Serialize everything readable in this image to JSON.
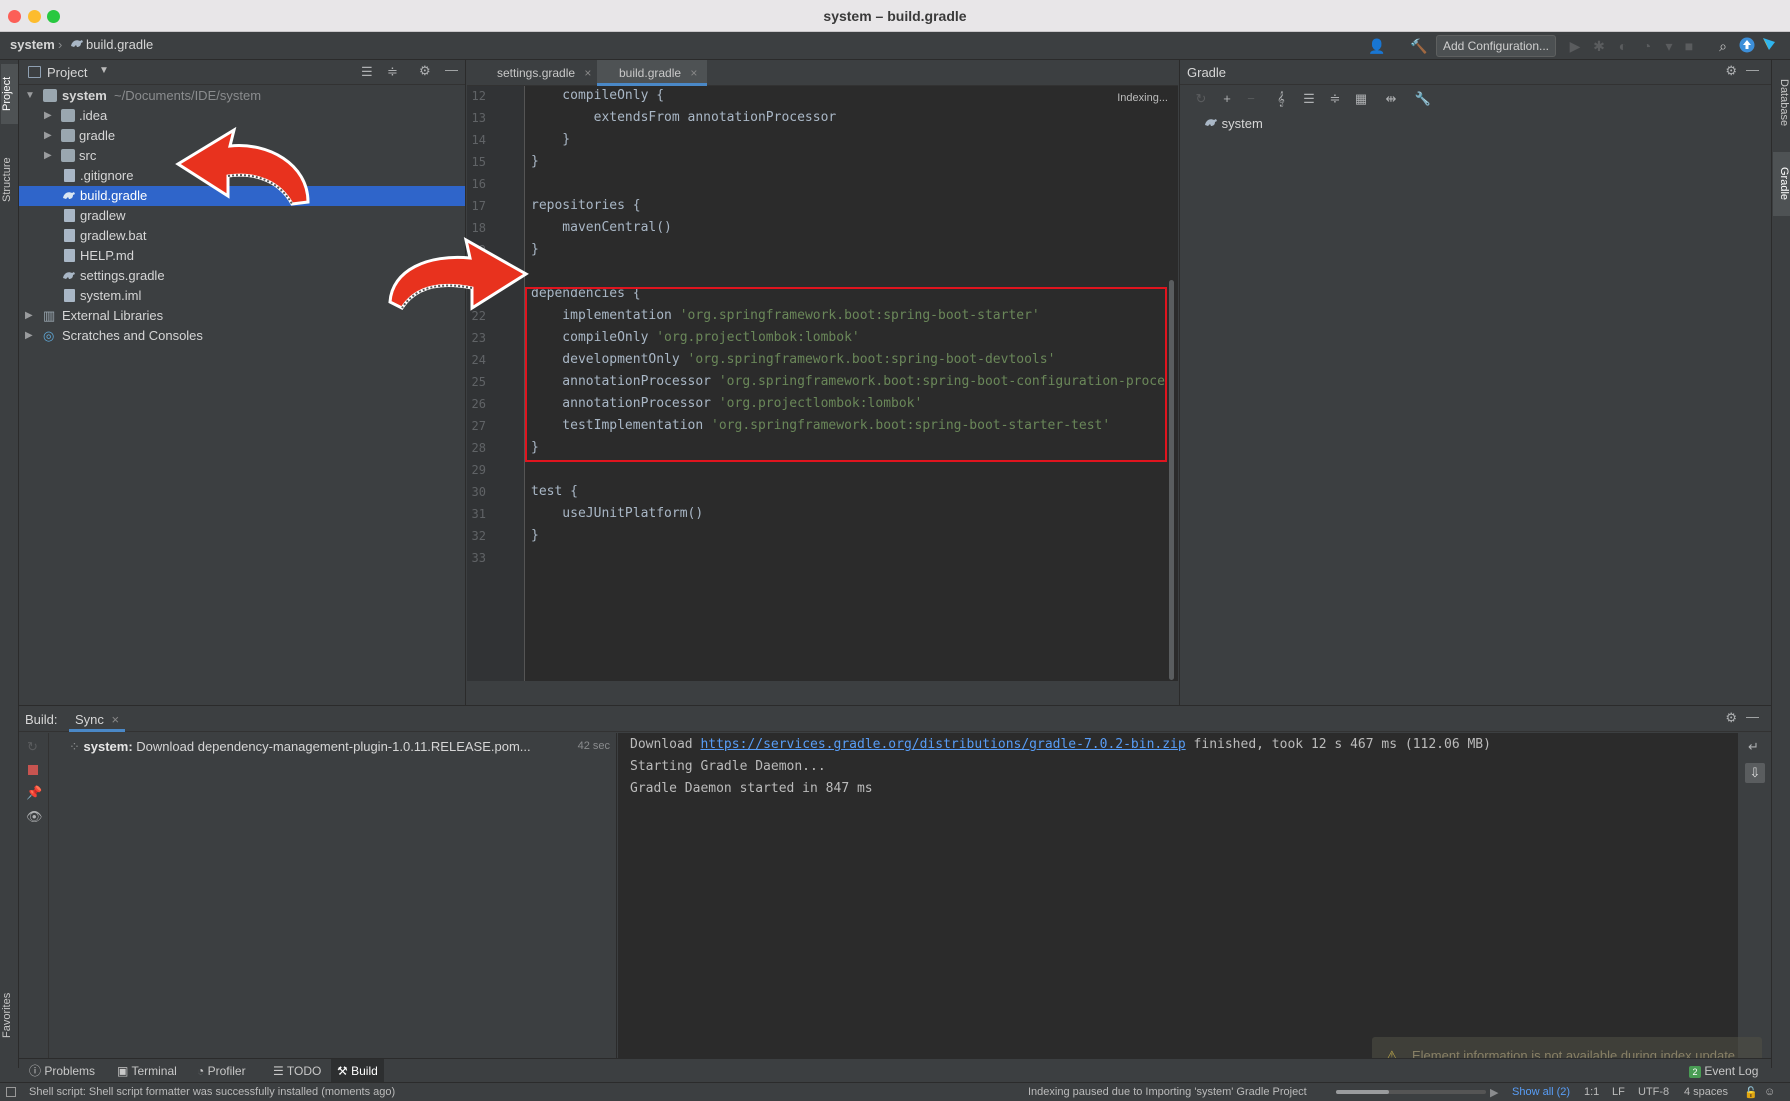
{
  "window": {
    "title": "system – build.gradle"
  },
  "navbar": {
    "crumb_project": "system",
    "crumb_file": "build.gradle",
    "add_configuration": "Add Configuration..."
  },
  "left_stripe": {
    "project": "Project",
    "structure": "Structure",
    "favorites": "Favorites"
  },
  "right_stripe": {
    "database": "Database",
    "gradle": "Gradle"
  },
  "project_panel": {
    "title": "Project",
    "root_name": "system",
    "root_path": "~/Documents/IDE/system",
    "items": [
      {
        "label": ".idea",
        "kind": "folder"
      },
      {
        "label": "gradle",
        "kind": "folder"
      },
      {
        "label": "src",
        "kind": "folder"
      },
      {
        "label": ".gitignore",
        "kind": "file"
      },
      {
        "label": "build.gradle",
        "kind": "gradle"
      },
      {
        "label": "gradlew",
        "kind": "file"
      },
      {
        "label": "gradlew.bat",
        "kind": "file"
      },
      {
        "label": "HELP.md",
        "kind": "file"
      },
      {
        "label": "settings.gradle",
        "kind": "gradle"
      },
      {
        "label": "system.iml",
        "kind": "file"
      }
    ],
    "external_libraries": "External Libraries",
    "scratches": "Scratches and Consoles"
  },
  "editor": {
    "tabs": [
      {
        "label": "settings.gradle"
      },
      {
        "label": "build.gradle"
      }
    ],
    "indexing_status": "Indexing...",
    "lines": [
      {
        "n": "12",
        "code": "    compileOnly {",
        "str": ""
      },
      {
        "n": "13",
        "code": "        extendsFrom annotationProcessor",
        "str": ""
      },
      {
        "n": "14",
        "code": "    }",
        "str": ""
      },
      {
        "n": "15",
        "code": "}",
        "str": ""
      },
      {
        "n": "16",
        "code": "",
        "str": ""
      },
      {
        "n": "17",
        "code": "repositories {",
        "str": ""
      },
      {
        "n": "18",
        "code": "    mavenCentral()",
        "str": ""
      },
      {
        "n": "19",
        "code": "}",
        "str": ""
      },
      {
        "n": "20",
        "code": "",
        "str": ""
      },
      {
        "n": "21",
        "code": "dependencies {",
        "str": ""
      },
      {
        "n": "22",
        "code": "    implementation ",
        "str": "'org.springframework.boot:spring-boot-starter'"
      },
      {
        "n": "23",
        "code": "    compileOnly ",
        "str": "'org.projectlombok:lombok'"
      },
      {
        "n": "24",
        "code": "    developmentOnly ",
        "str": "'org.springframework.boot:spring-boot-devtools'"
      },
      {
        "n": "25",
        "code": "    annotationProcessor ",
        "str": "'org.springframework.boot:spring-boot-configuration-proce"
      },
      {
        "n": "26",
        "code": "    annotationProcessor ",
        "str": "'org.projectlombok:lombok'"
      },
      {
        "n": "27",
        "code": "    testImplementation ",
        "str": "'org.springframework.boot:spring-boot-starter-test'"
      },
      {
        "n": "28",
        "code": "}",
        "str": ""
      },
      {
        "n": "29",
        "code": "",
        "str": ""
      },
      {
        "n": "30",
        "code": "test {",
        "str": ""
      },
      {
        "n": "31",
        "code": "    useJUnitPlatform()",
        "str": ""
      },
      {
        "n": "32",
        "code": "}",
        "str": ""
      },
      {
        "n": "33",
        "code": "",
        "str": ""
      }
    ]
  },
  "gradle_panel": {
    "title": "Gradle",
    "root": "system"
  },
  "build": {
    "label": "Build:",
    "tab": "Sync",
    "task_prefix": "system:",
    "task_text": "Download dependency-management-plugin-1.0.11.RELEASE.pom...",
    "task_time": "42 sec",
    "console": {
      "line1_prefix": "Download ",
      "line1_link": "https://services.gradle.org/distributions/gradle-7.0.2-bin.zip",
      "line1_suffix": " finished, took 12 s 467 ms (112.06 MB)",
      "line2": "Starting Gradle Daemon...",
      "line3": "Gradle Daemon started in 847 ms"
    },
    "notice": "Element information is not available during index update"
  },
  "bottom_tabs": {
    "problems": "Problems",
    "terminal": "Terminal",
    "profiler": "Profiler",
    "todo": "TODO",
    "build": "Build",
    "event_log": "Event Log",
    "event_count": "2"
  },
  "status_bar": {
    "message": "Shell script: Shell script formatter was successfully installed (moments ago)",
    "indexing": "Indexing paused due to Importing 'system' Gradle Project",
    "show_all": "Show all (2)",
    "position": "1:1",
    "line_sep": "LF",
    "encoding": "UTF-8",
    "indent": "4 spaces"
  },
  "colors": {
    "selection": "#2f65ca",
    "highlight_box": "#e0141e",
    "string": "#6a8759",
    "link": "#589df6"
  }
}
